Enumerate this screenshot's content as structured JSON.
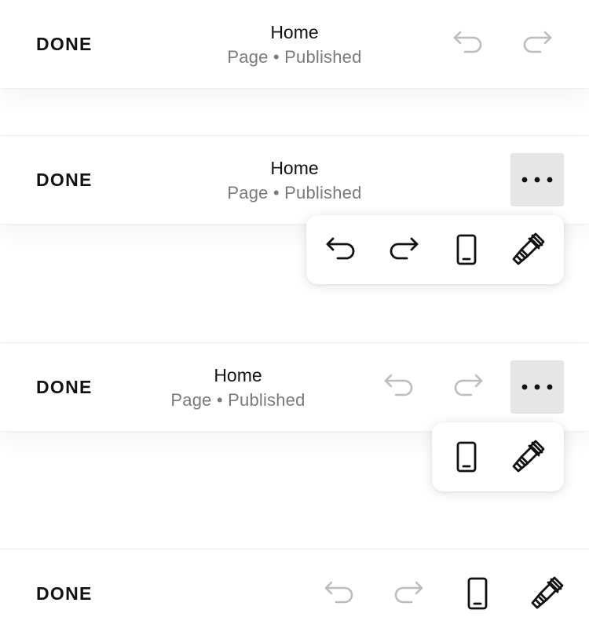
{
  "colors": {
    "text": "#111111",
    "subtext": "#7a7a7a",
    "disabled_icon": "#bcbcbc",
    "more_button_bg": "#e6e6e6"
  },
  "header": {
    "done_label": "DONE",
    "title": "Home",
    "subtitle": "Page • Published"
  },
  "icons": {
    "undo": "undo-icon",
    "redo": "redo-icon",
    "more": "more-horizontal-icon",
    "mobile": "mobile-preview-icon",
    "brush": "paintbrush-icon"
  }
}
